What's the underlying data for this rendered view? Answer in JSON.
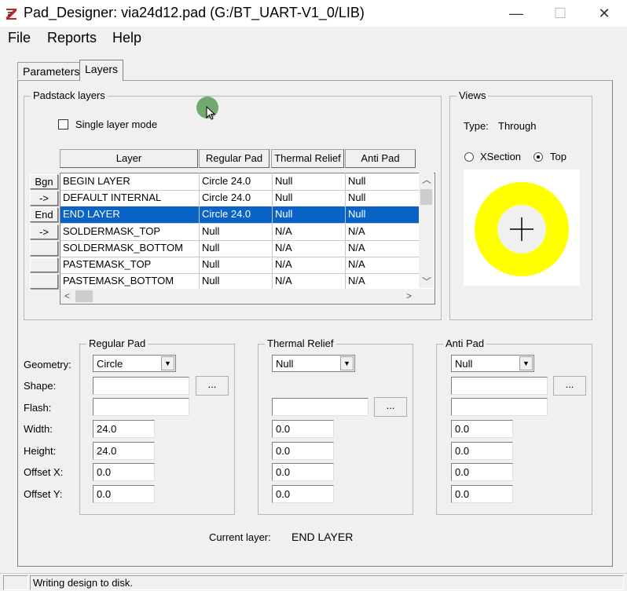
{
  "window": {
    "title": "Pad_Designer: via24d12.pad (G:/BT_UART-V1_0/LIB)",
    "minimize": "—",
    "maximize": "☐",
    "close": "✕"
  },
  "menu": [
    "File",
    "Reports",
    "Help"
  ],
  "tabs": {
    "parameters": "Parameters",
    "layers": "Layers"
  },
  "padstack": {
    "title": "Padstack layers",
    "single_layer_label": "Single layer mode",
    "single_layer_checked": false,
    "columns": [
      "Layer",
      "Regular Pad",
      "Thermal Relief",
      "Anti Pad"
    ],
    "row_buttons": [
      "Bgn",
      "->",
      "End",
      "->",
      "",
      "",
      ""
    ],
    "rows": [
      {
        "layer": "BEGIN LAYER",
        "regular": "Circle 24.0",
        "thermal": "Null",
        "anti": "Null"
      },
      {
        "layer": "DEFAULT INTERNAL",
        "regular": "Circle 24.0",
        "thermal": "Null",
        "anti": "Null"
      },
      {
        "layer": "END LAYER",
        "regular": "Circle 24.0",
        "thermal": "Null",
        "anti": "Null"
      },
      {
        "layer": "SOLDERMASK_TOP",
        "regular": "Null",
        "thermal": "N/A",
        "anti": "N/A"
      },
      {
        "layer": "SOLDERMASK_BOTTOM",
        "regular": "Null",
        "thermal": "N/A",
        "anti": "N/A"
      },
      {
        "layer": "PASTEMASK_TOP",
        "regular": "Null",
        "thermal": "N/A",
        "anti": "N/A"
      },
      {
        "layer": "PASTEMASK_BOTTOM",
        "regular": "Null",
        "thermal": "N/A",
        "anti": "N/A"
      }
    ],
    "selected_row": "END LAYER"
  },
  "views": {
    "title": "Views",
    "type_label": "Type:",
    "type_value": "Through",
    "xsection_label": "XSection",
    "top_label": "Top",
    "selected": "Top",
    "pad_color": "#ffff00"
  },
  "regular_pad": {
    "title": "Regular Pad",
    "geometry": "Circle",
    "shape": "",
    "flash": "",
    "width": "24.0",
    "height": "24.0",
    "offset_x": "0.0",
    "offset_y": "0.0",
    "browse": "..."
  },
  "thermal_relief": {
    "title": "Thermal Relief",
    "geometry": "Null",
    "flash": "",
    "width": "0.0",
    "height": "0.0",
    "offset_x": "0.0",
    "offset_y": "0.0",
    "browse": "..."
  },
  "anti_pad": {
    "title": "Anti Pad",
    "geometry": "Null",
    "shape": "",
    "flash": "",
    "width": "0.0",
    "height": "0.0",
    "offset_x": "0.0",
    "offset_y": "0.0",
    "browse": "..."
  },
  "field_labels": {
    "geometry": "Geometry:",
    "shape": "Shape:",
    "flash": "Flash:",
    "width": "Width:",
    "height": "Height:",
    "offset_x": "Offset X:",
    "offset_y": "Offset Y:"
  },
  "current_layer": {
    "label": "Current layer:",
    "value": "END LAYER"
  },
  "status": {
    "message": "Writing design to disk."
  },
  "colors": {
    "selection": "#0a64c8",
    "pad": "#ffff00"
  }
}
